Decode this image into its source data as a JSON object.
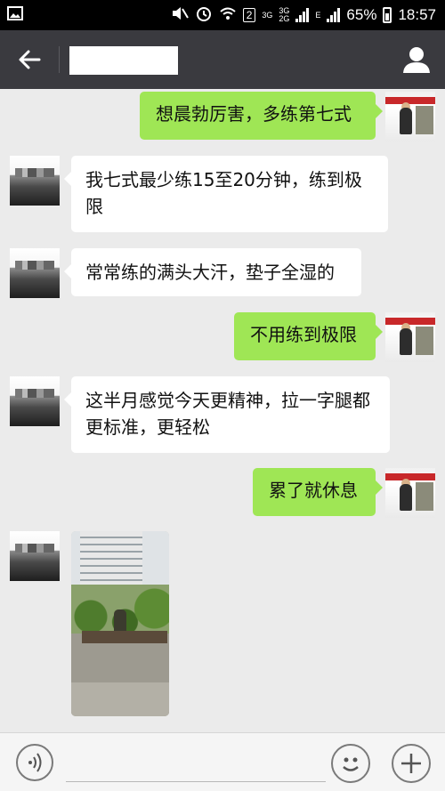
{
  "status_bar": {
    "sim_slot": "2",
    "net_top": "3G",
    "net_mid": "3G",
    "net_bottom": "2G",
    "net_e": "E",
    "battery_percent": "65%",
    "time": "18:57"
  },
  "chat": {
    "title": ""
  },
  "messages": [
    {
      "side": "right",
      "text": "想晨勃厉害，多练第七式"
    },
    {
      "side": "left",
      "text_line1": "我七式最少练15至20分钟，练到极",
      "text_line2": "限"
    },
    {
      "side": "left",
      "text": "常常练的满头大汗，垫子全湿的"
    },
    {
      "side": "right",
      "text": "不用练到极限"
    },
    {
      "side": "left",
      "text_line1": "这半月感觉今天更精神，拉一字腿都",
      "text_line2": "更标准，更轻松"
    },
    {
      "side": "right",
      "text": "累了就休息"
    },
    {
      "side": "left",
      "type": "image"
    }
  ],
  "input": {
    "value": "",
    "placeholder": ""
  },
  "icons": {
    "back": "back-arrow-icon",
    "profile": "person-icon",
    "voice": "voice-icon",
    "emoji": "emoji-icon",
    "plus": "plus-icon"
  }
}
